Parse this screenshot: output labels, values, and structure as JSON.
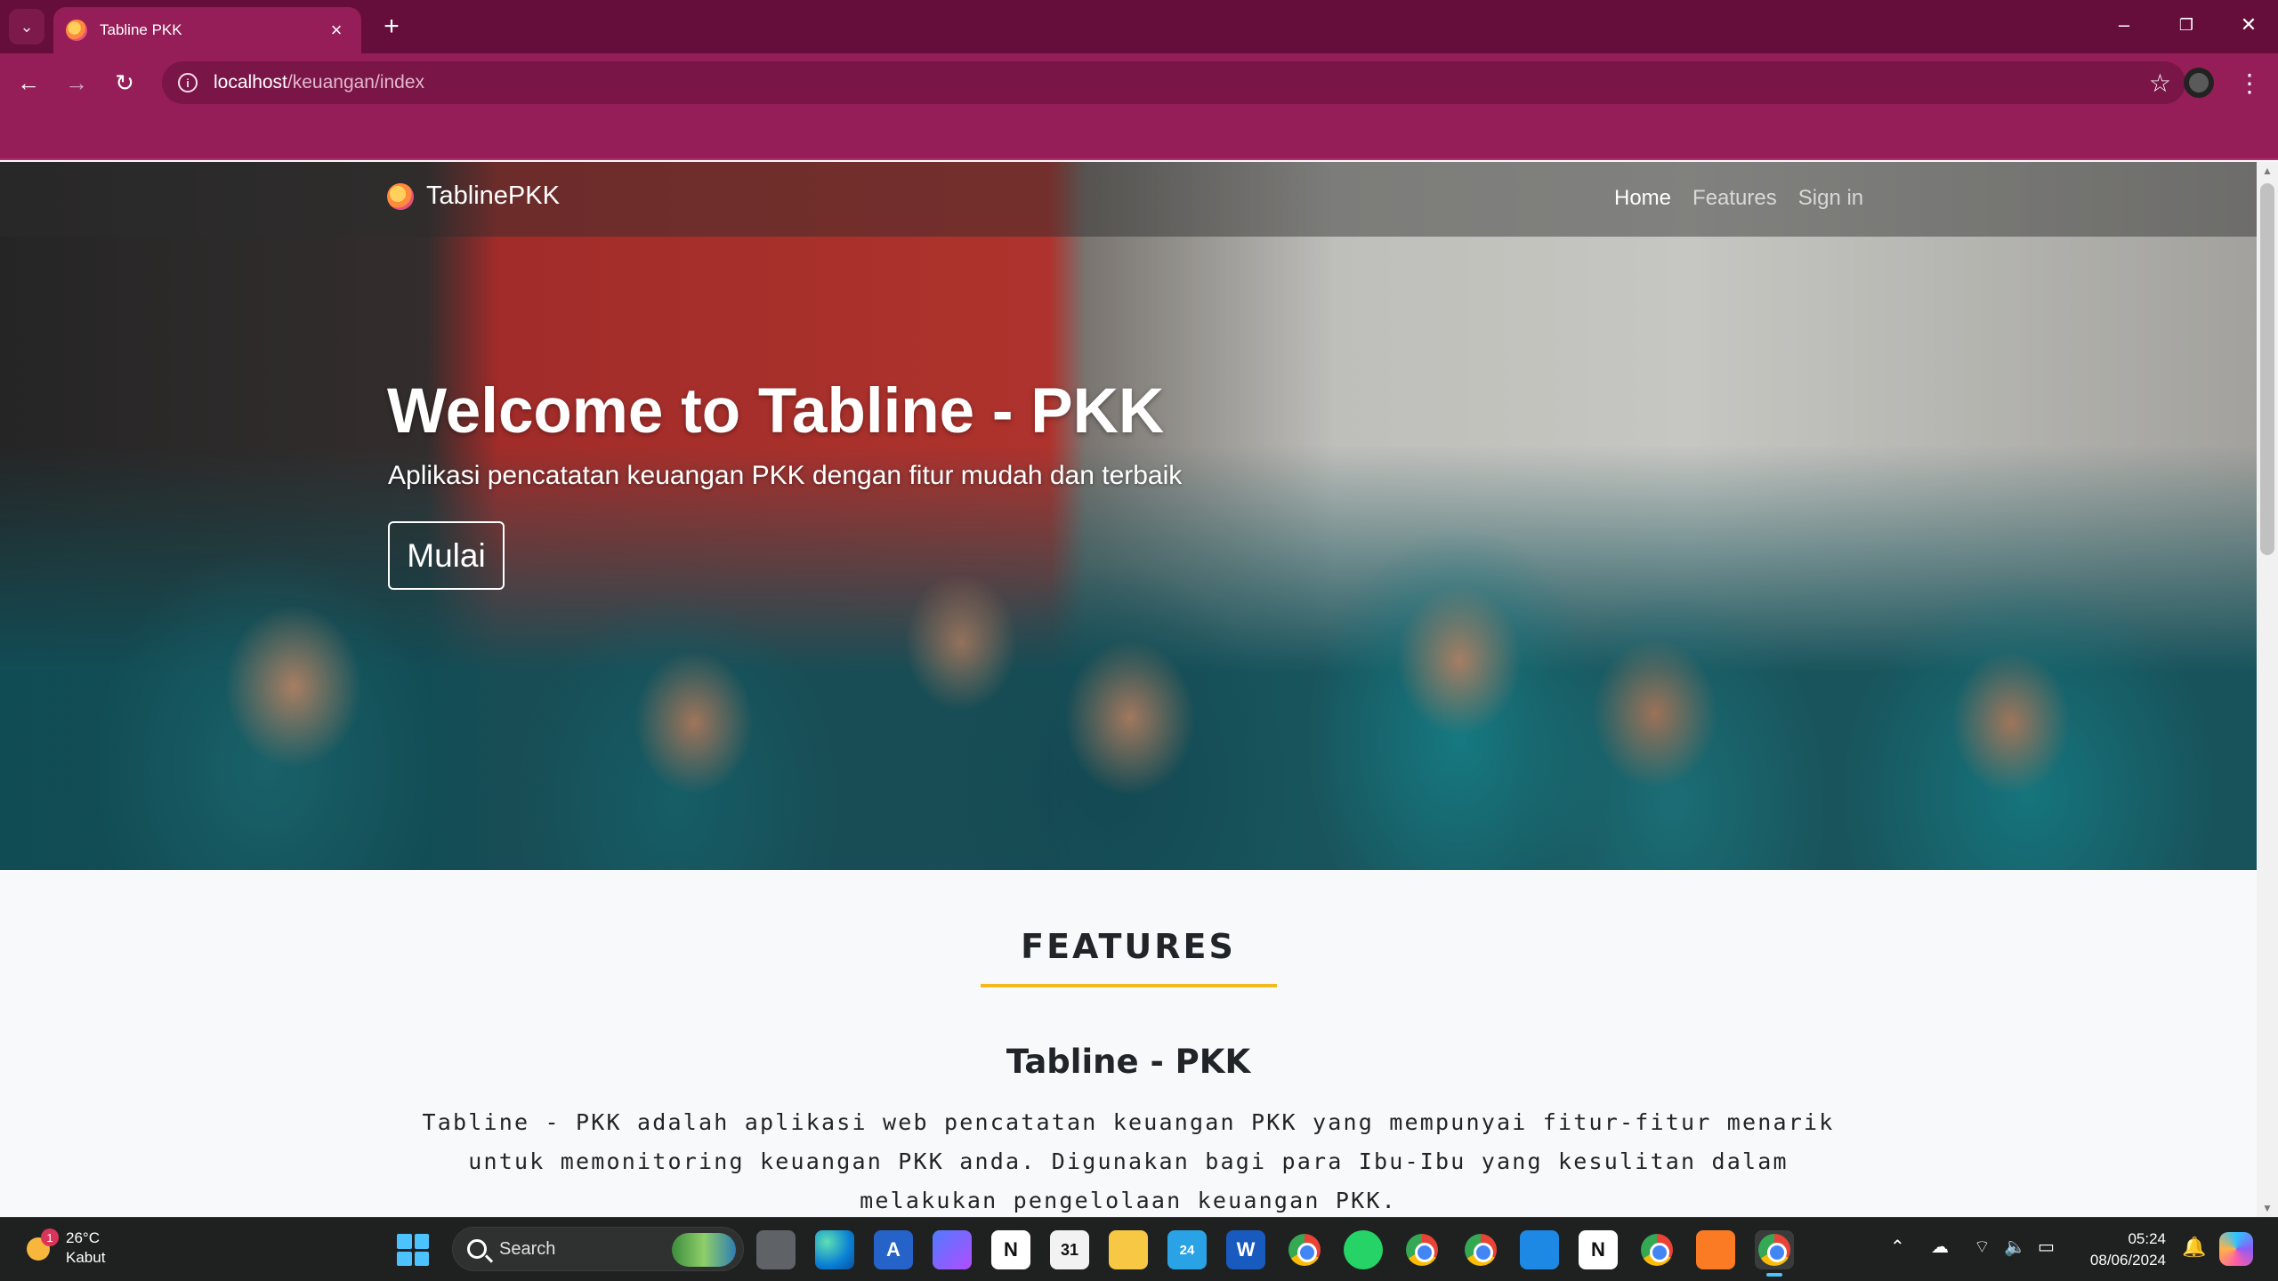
{
  "browser": {
    "tab_title": "Tabline PKK",
    "url_host": "localhost",
    "url_path": "/keuangan/index",
    "icons": [
      "tab-search-icon",
      "close-icon",
      "plus-icon",
      "minimize-icon",
      "restore-icon",
      "window-close-icon",
      "back-arrow-icon",
      "forward-arrow-icon",
      "reload-icon",
      "site-info-icon",
      "bookmark-star-icon",
      "profile-avatar",
      "more-menu-icon"
    ],
    "colors": {
      "tabstrip": "#650d3b",
      "toolbar": "#951d58"
    }
  },
  "site": {
    "brand": "TablinePKK",
    "nav": [
      "Home",
      "Features",
      "Sign in"
    ],
    "active_nav": "Home",
    "hero": {
      "title": "Welcome to Tabline - PKK",
      "subtitle": "Aplikasi pencatatan keuangan PKK dengan fitur mudah dan terbaik",
      "button": "Mulai"
    },
    "features": {
      "heading": "FEATURES",
      "title": "Tabline - PKK",
      "body": "Tabline - PKK adalah aplikasi web pencatatan keuangan PKK yang mempunyai fitur-fitur menarik untuk memonitoring keuangan PKK anda. Digunakan bagi para Ibu-Ibu yang kesulitan dalam melakukan pengelolaan keuangan PKK.",
      "accent": "#f2b91f"
    }
  },
  "taskbar": {
    "weather": {
      "temp": "26°C",
      "condition": "Kabut",
      "badge": "1"
    },
    "search_placeholder": "Search",
    "telegram_badge": "24",
    "calendar_label": "31",
    "word_label": "W",
    "notion_label": "N",
    "time": "05:24",
    "date": "08/06/2024"
  }
}
